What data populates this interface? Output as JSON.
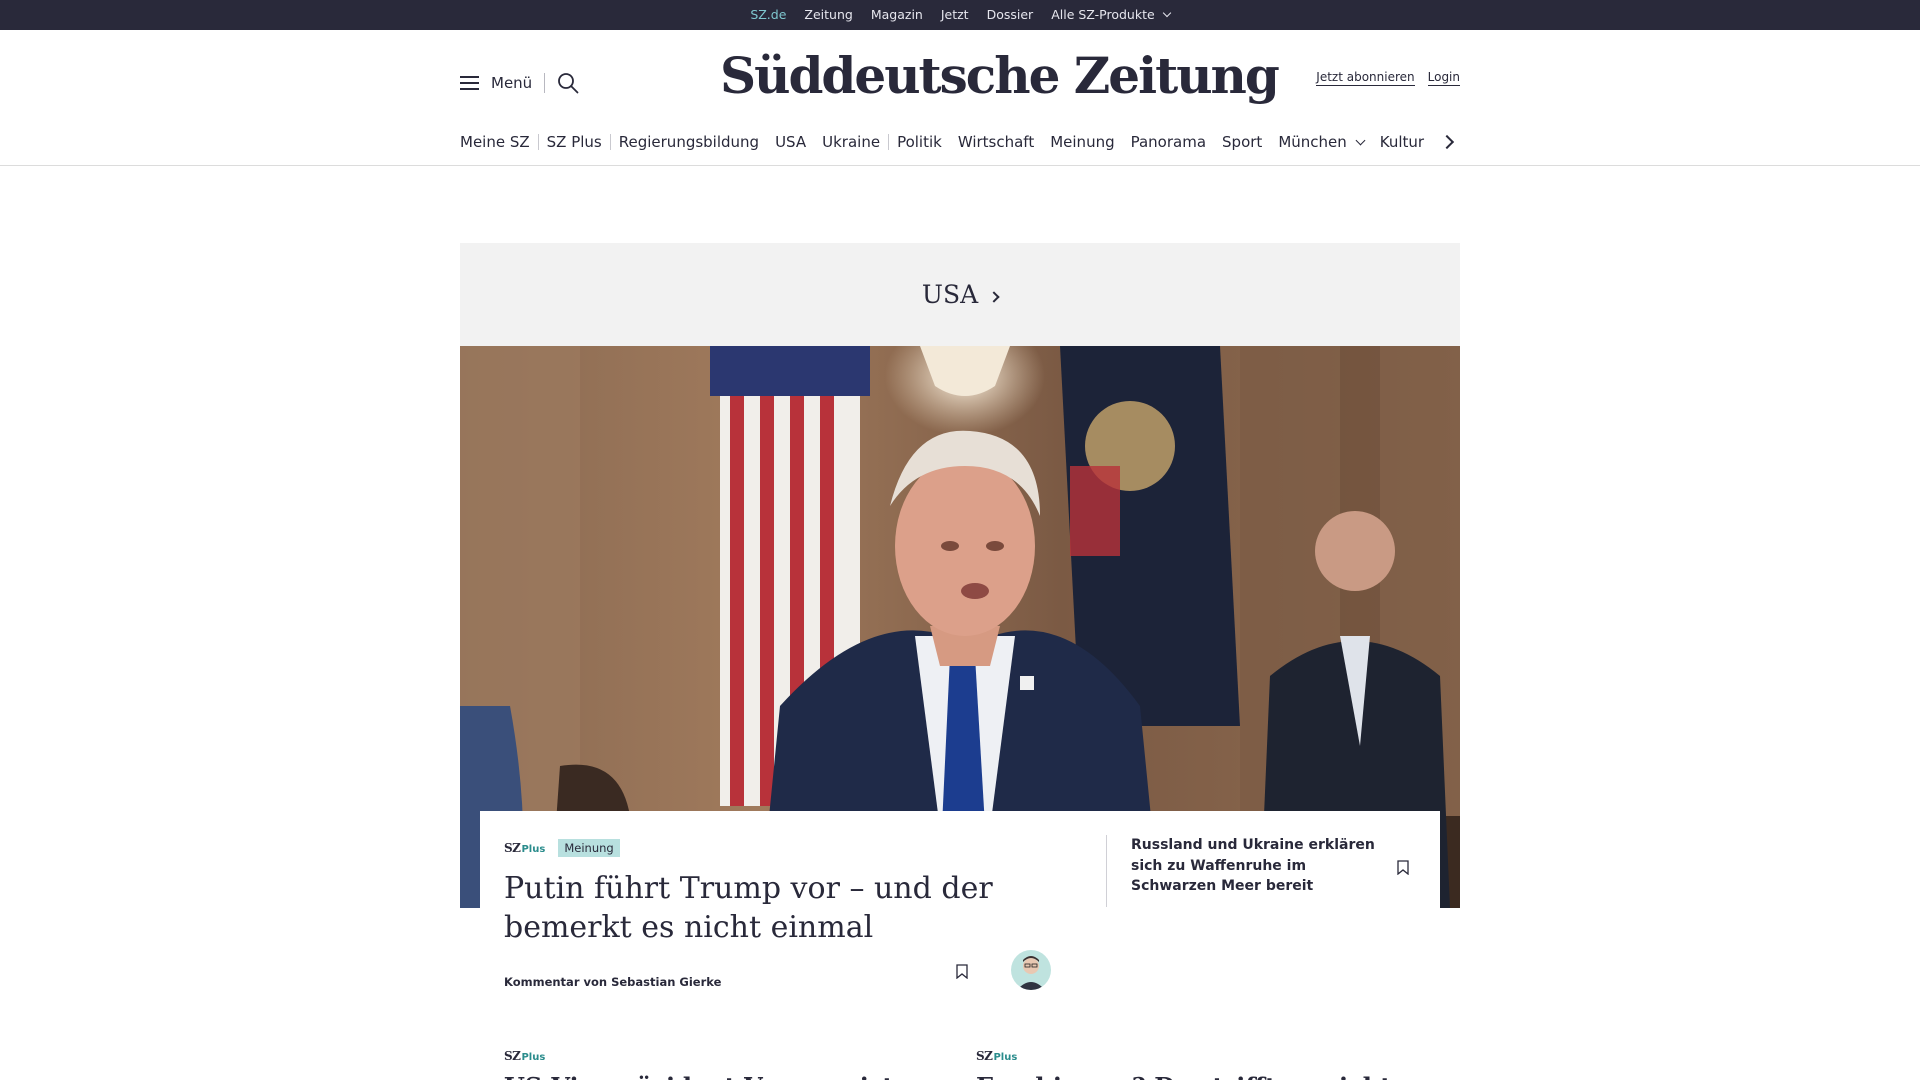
{
  "topbar": {
    "items": [
      "SZ.de",
      "Zeitung",
      "Magazin",
      "Jetzt",
      "Dossier",
      "Alle SZ-Produkte"
    ]
  },
  "header": {
    "menu_label": "Menü",
    "logo": "Süddeutsche Zeitung",
    "subscribe": "Jetzt abonnieren",
    "login": "Login"
  },
  "nav": {
    "items": [
      "Meine SZ",
      "SZ Plus",
      "Regierungsbildung",
      "USA",
      "Ukraine",
      "Politik",
      "Wirtschaft",
      "Meinung",
      "Panorama",
      "Sport",
      "München",
      "Kultur"
    ]
  },
  "section": {
    "title": "USA"
  },
  "lead_article": {
    "brand": "SZ",
    "brand_plus": "Plus",
    "badge": "Meinung",
    "title": "Putin führt Trump vor – und der bemerkt es nicht einmal",
    "byline": "Kommentar von Sebastian Gierke"
  },
  "side_article": {
    "title": "Russland und Ukraine erklären sich zu Waffenruhe im Schwarzen Meer bereit"
  },
  "teasers": [
    {
      "brand": "SZ",
      "brand_plus": "Plus",
      "title": "US-Vizepräsident Vance reist"
    },
    {
      "brand": "SZ",
      "brand_plus": "Plus",
      "title": "Faschismus? Das trifft es nicht"
    }
  ],
  "colors": {
    "topbar_bg": "#29293a",
    "text": "#29293a",
    "accent_teal": "#7fc7cf",
    "badge_bg": "#b8e0df",
    "section_bg": "#f2f2f2"
  }
}
